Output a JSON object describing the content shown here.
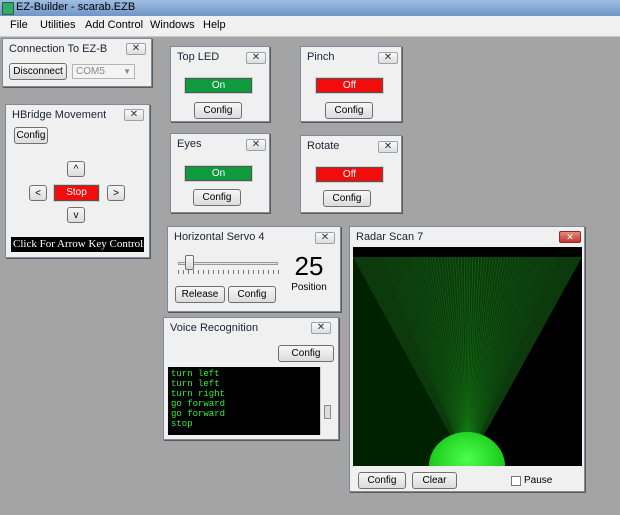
{
  "window": {
    "title": "EZ-Builder - scarab.EZB"
  },
  "menu": [
    "File",
    "Utilities",
    "Add Control",
    "Windows",
    "Help"
  ],
  "connection": {
    "title": "Connection To EZ-B",
    "disconnect_label": "Disconnect",
    "port": "COM5"
  },
  "hbridge": {
    "title": "HBridge Movement",
    "config_label": "Config",
    "up_label": "^",
    "left_label": "<",
    "stop_label": "Stop",
    "right_label": ">",
    "down_label": "v",
    "keyboard_label": "Click For Arrow Key Control"
  },
  "top_led": {
    "title": "Top LED",
    "state_label": "On",
    "config_label": "Config",
    "state_color": "#0e9b3e"
  },
  "eyes": {
    "title": "Eyes",
    "state_label": "On",
    "config_label": "Config",
    "state_color": "#0e9b3e"
  },
  "pinch": {
    "title": "Pinch",
    "state_label": "Off",
    "config_label": "Config",
    "state_color": "#f20d0d"
  },
  "rotate": {
    "title": "Rotate",
    "state_label": "Off",
    "config_label": "Config",
    "state_color": "#f20d0d"
  },
  "servo": {
    "title": "Horizontal Servo 4",
    "value": "25",
    "value_label": "Position",
    "slider_fraction": 0.08,
    "release_label": "Release",
    "config_label": "Config"
  },
  "voice": {
    "title": "Voice Recognition",
    "config_label": "Config",
    "log": [
      "turn left",
      "turn left",
      "turn right",
      "go forward",
      "go forward",
      "stop"
    ]
  },
  "radar": {
    "title": "Radar Scan 7",
    "config_label": "Config",
    "clear_label": "Clear",
    "pause_label": "Pause",
    "close_glyph": "✕",
    "beam_color": "#1fbf1f"
  },
  "close_glyph": "✕"
}
